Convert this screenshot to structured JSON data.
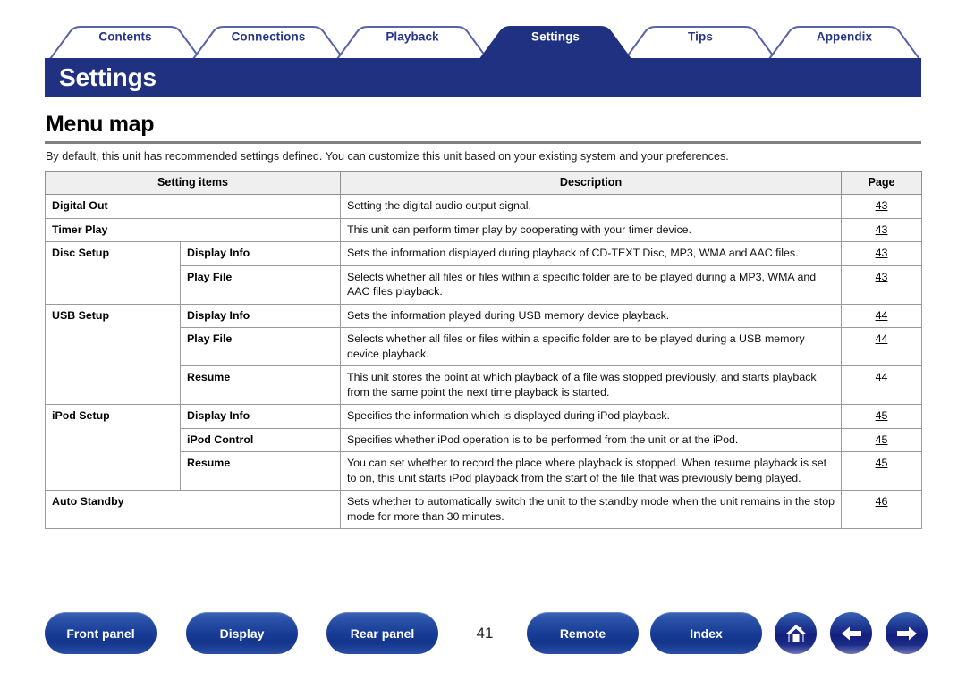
{
  "tabs": [
    {
      "label": "Contents",
      "active": false
    },
    {
      "label": "Connections",
      "active": false
    },
    {
      "label": "Playback",
      "active": false
    },
    {
      "label": "Settings",
      "active": true
    },
    {
      "label": "Tips",
      "active": false
    },
    {
      "label": "Appendix",
      "active": false
    }
  ],
  "banner": {
    "title": "Settings"
  },
  "section": {
    "heading": "Menu map",
    "intro": "By default, this unit has recommended settings defined. You can customize this unit based on your existing system and your preferences."
  },
  "table": {
    "headers": {
      "setting_items": "Setting items",
      "description": "Description",
      "page": "Page"
    },
    "rows": [
      {
        "item": "Digital Out",
        "subitem": "",
        "span_items": true,
        "description": "Setting the digital audio output signal.",
        "page": "43"
      },
      {
        "item": "Timer Play",
        "subitem": "",
        "span_items": true,
        "description": "This unit can perform timer play by cooperating with your timer device.",
        "page": "43"
      },
      {
        "item": "Disc Setup",
        "item_rowspan": 2,
        "subitem": "Display Info",
        "description": "Sets the information displayed during playback of CD-TEXT Disc, MP3, WMA and AAC files.",
        "page": "43"
      },
      {
        "item": "",
        "subitem": "Play File",
        "description": "Selects whether all files or files within a specific folder are to be played during a MP3, WMA and AAC files playback.",
        "page": "43"
      },
      {
        "item": "USB Setup",
        "item_rowspan": 3,
        "subitem": "Display Info",
        "description": "Sets the information played during USB memory device playback.",
        "page": "44"
      },
      {
        "item": "",
        "subitem": "Play File",
        "description": "Selects whether all files or files within a specific folder are to be played during a USB memory device playback.",
        "page": "44"
      },
      {
        "item": "",
        "subitem": "Resume",
        "description": "This unit stores the point at which playback of a file was stopped previously, and starts playback from the same point the next time playback is started.",
        "page": "44"
      },
      {
        "item": "iPod Setup",
        "item_rowspan": 3,
        "subitem": "Display Info",
        "description": "Specifies the information which is displayed during iPod playback.",
        "page": "45"
      },
      {
        "item": "",
        "subitem": "iPod Control",
        "description": "Specifies whether iPod operation is to be performed from the unit or at the iPod.",
        "page": "45"
      },
      {
        "item": "",
        "subitem": "Resume",
        "description": "You can set whether to record the place where playback is stopped. When resume playback is set to on, this unit starts iPod playback from the start of the file that was previously being played.",
        "page": "45"
      },
      {
        "item": "Auto Standby",
        "subitem": "",
        "span_items": true,
        "justify": true,
        "description": "Sets whether to automatically switch the unit to the standby mode when the unit remains in the stop mode for more than 30 minutes.",
        "page": "46"
      }
    ]
  },
  "footer": {
    "buttons": [
      {
        "label": "Front panel",
        "name": "front-panel-button"
      },
      {
        "label": "Display",
        "name": "display-button"
      },
      {
        "label": "Rear panel",
        "name": "rear-panel-button"
      },
      {
        "label": "Remote",
        "name": "remote-button"
      },
      {
        "label": "Index",
        "name": "index-button"
      }
    ],
    "page_number": "41",
    "icons": [
      {
        "name": "home-icon"
      },
      {
        "name": "arrow-left-icon"
      },
      {
        "name": "arrow-right-icon"
      }
    ]
  },
  "colors": {
    "brand_navy": "#1F3180",
    "tab_text": "#27348B",
    "rule_gray": "#808080",
    "table_border": "#9a9a9a",
    "header_fill": "#efefef"
  }
}
